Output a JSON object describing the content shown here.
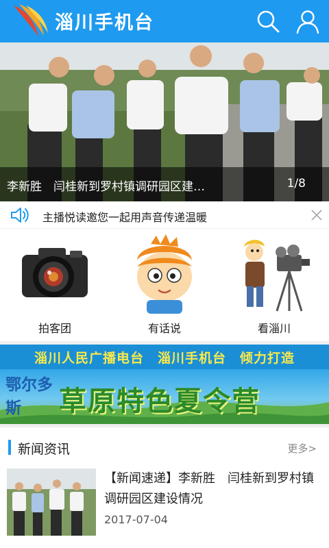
{
  "header": {
    "title": "淄川手机台",
    "logo_icon": "flame-swoosh-logo",
    "search_icon": "search-icon",
    "user_icon": "user-icon"
  },
  "banner": {
    "caption": "李新胜　闫桂新到罗村镇调研园区建…",
    "counter": "1/8"
  },
  "notice": {
    "icon": "speaker-icon",
    "text": "主播悦读邀您一起用声音传递温暖",
    "close_icon": "close-icon"
  },
  "quick_links": [
    {
      "label": "拍客团",
      "icon": "camera-icon"
    },
    {
      "label": "有话说",
      "icon": "cartoon-boy-icon"
    },
    {
      "label": "看淄川",
      "icon": "cartoon-cameraman-icon"
    }
  ],
  "ad_banner": {
    "headline": "淄川人民广播电台　淄川手机台　倾力打造",
    "place": "鄂尔多斯",
    "title": "草原特色夏令营"
  },
  "news": {
    "heading": "新闻资讯",
    "more": "更多>",
    "items": [
      {
        "title": "【新闻速递】李新胜　闫桂新到罗村镇调研园区建设情况",
        "date": "2017-07-04"
      }
    ]
  },
  "colors": {
    "brand_blue": "#1e9af0",
    "ad_yellow": "#f8e94a",
    "ad_green": "#2c8a2a"
  }
}
